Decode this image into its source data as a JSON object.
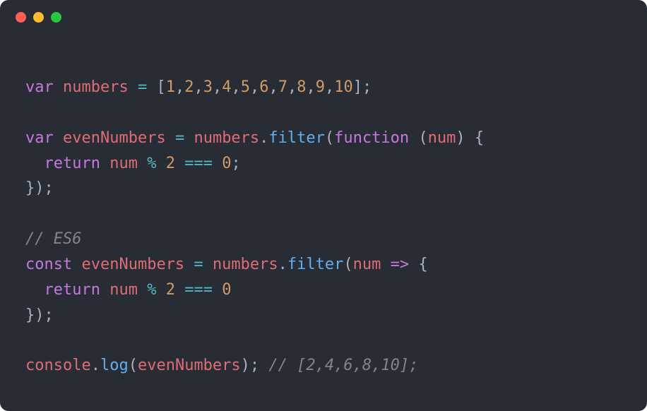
{
  "titlebar": {
    "close": "",
    "minimize": "",
    "maximize": ""
  },
  "code": {
    "l1_var": "var",
    "l1_numbers": "numbers",
    "l1_eq": " = ",
    "l1_lb": "[",
    "l1_n1": "1",
    "l1_c1": ",",
    "l1_n2": "2",
    "l1_c2": ",",
    "l1_n3": "3",
    "l1_c3": ",",
    "l1_n4": "4",
    "l1_c4": ",",
    "l1_n5": "5",
    "l1_c5": ",",
    "l1_n6": "6",
    "l1_c6": ",",
    "l1_n7": "7",
    "l1_c7": ",",
    "l1_n8": "8",
    "l1_c8": ",",
    "l1_n9": "9",
    "l1_c9": ",",
    "l1_n10": "10",
    "l1_rb": "];",
    "l3_var": "var",
    "l3_even": "evenNumbers",
    "l3_eq": " = ",
    "l3_numbers": "numbers",
    "l3_dot": ".",
    "l3_filter": "filter",
    "l3_lp": "(",
    "l3_function": "function",
    "l3_lp2": " (",
    "l3_num": "num",
    "l3_rp": ") {",
    "l4_return": "  return",
    "l4_num": "num",
    "l4_mod": " % ",
    "l4_two": "2",
    "l4_eqeq": " === ",
    "l4_zero": "0",
    "l4_semi": ";",
    "l5_close": "});",
    "l7_comment": "// ES6",
    "l8_const": "const",
    "l8_even": "evenNumbers",
    "l8_eq": " = ",
    "l8_numbers": "numbers",
    "l8_dot": ".",
    "l8_filter": "filter",
    "l8_lp": "(",
    "l8_num": "num",
    "l8_arrow": " => ",
    "l8_lb": "{",
    "l9_return": "  return",
    "l9_num": "num",
    "l9_mod": " % ",
    "l9_two": "2",
    "l9_eqeq": " === ",
    "l9_zero": "0",
    "l10_close": "});",
    "l12_console": "console",
    "l12_dot": ".",
    "l12_log": "log",
    "l12_lp": "(",
    "l12_even": "evenNumbers",
    "l12_rp": "); ",
    "l12_comment": "// [2,4,6,8,10];"
  }
}
